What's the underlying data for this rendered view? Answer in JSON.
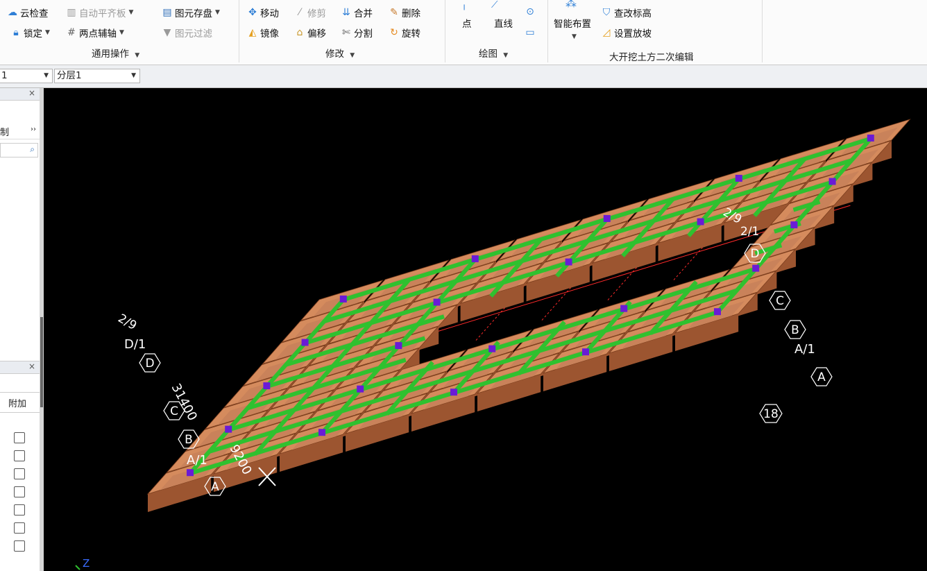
{
  "ribbon": {
    "common_ops": {
      "cloud_check": "云检查",
      "auto_level": "自动平齐板",
      "save_elements": "图元存盘",
      "lock": "锁定",
      "two_point_axis": "两点辅轴",
      "element_filter": "图元过滤",
      "group_title": "通用操作"
    },
    "modify": {
      "move": "移动",
      "trim": "修剪",
      "merge": "合并",
      "delete": "删除",
      "mirror": "镜像",
      "offset": "偏移",
      "split": "分割",
      "rotate": "旋转",
      "group_title": "修改"
    },
    "draw": {
      "point": "点",
      "line": "直线",
      "group_title": "绘图"
    },
    "excavation": {
      "smart_layout": "智能布置",
      "check_elevation": "查改标高",
      "set_slope": "设置放坡",
      "group_title": "大开挖土方二次编辑"
    }
  },
  "toolbar2": {
    "floor_value": "1",
    "layer_value": "分层1"
  },
  "left_panel": {
    "tab_label": "制",
    "column_header": "附加",
    "close_symbol": "×",
    "more_symbol": "››"
  },
  "viewport": {
    "axis_labels_left": [
      "D",
      "C",
      "B",
      "A/1",
      "A",
      "D/1",
      "2/9"
    ],
    "axis_labels_right": [
      "D",
      "C",
      "B",
      "A/1",
      "A",
      "18",
      "2/9",
      "2/1"
    ],
    "dimension_texts": [
      "31400",
      "9200"
    ],
    "axis_indicator": "Z"
  },
  "colors": {
    "pit_face": "#c9825a",
    "pit_wall": "#9c5530",
    "beam": "#2fc12f",
    "column": "#6a1bd6",
    "grid_line": "#ff2a2a"
  }
}
